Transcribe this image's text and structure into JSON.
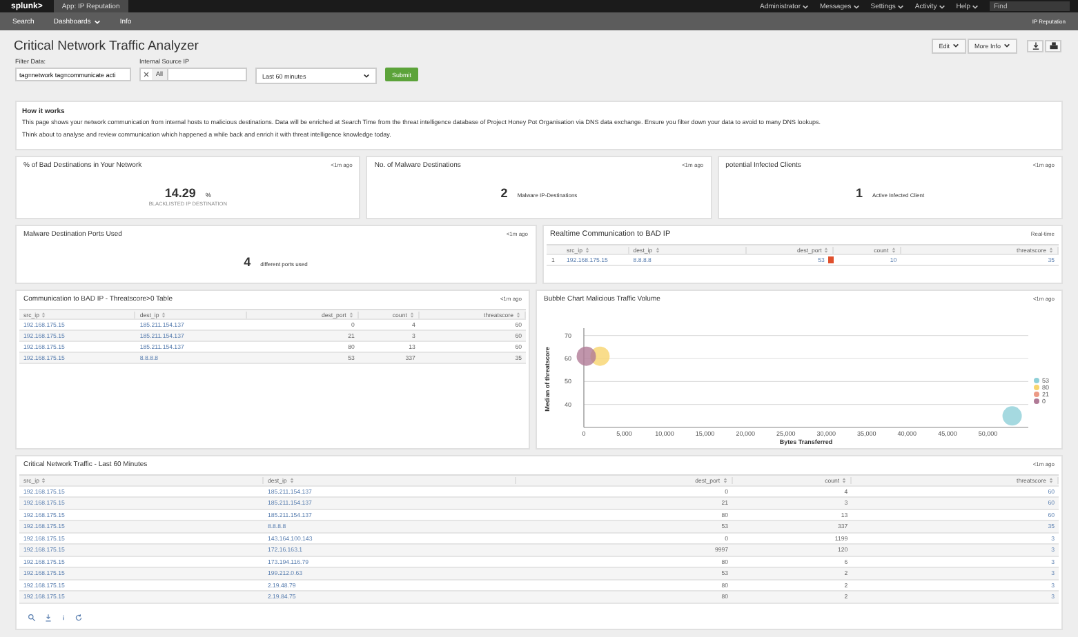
{
  "top_bar": {
    "logo": "splunk>",
    "app": "App: IP Reputation",
    "menus": [
      "Administrator",
      "Messages",
      "Settings",
      "Activity",
      "Help"
    ],
    "find_placeholder": "Find"
  },
  "nav": {
    "items": [
      {
        "label": "Search",
        "dropdown": false
      },
      {
        "label": "Dashboards",
        "dropdown": true
      },
      {
        "label": "Info",
        "dropdown": false
      }
    ],
    "app_label": "IP Reputation"
  },
  "dashboard": {
    "title": "Critical Network Traffic Analyzer",
    "buttons": [
      "Edit",
      "More Info"
    ]
  },
  "filters": {
    "filter_data": {
      "label": "Filter Data:",
      "value": "tag=network tag=communicate acti"
    },
    "source_ip": {
      "label": "Internal Source IP",
      "token": "All"
    },
    "time": {
      "value": "Last 60 minutes"
    },
    "submit": "Submit"
  },
  "how_it_works": {
    "heading": "How it works",
    "paragraphs": [
      "This page shows your network communication from internal hosts to malicious destinations. Data will be enriched at Search Time from the threat intelligence database of Project Honey Pot Organisation via DNS data exchange. Ensure you filter down your data to avoid to many DNS lookups.",
      "Think about to analyse and review communication which happened a while back and enrich it with threat intelligence knowledge today."
    ]
  },
  "single_panels": [
    {
      "title": "% of Bad Destinations in Your Network",
      "age": "<1m ago",
      "value": "14.29",
      "unit": "%",
      "caption": "BLACKLISTED IP DESTINATION"
    },
    {
      "title": "No. of Malware Destinations",
      "age": "<1m ago",
      "value": "2",
      "caption": "Malware IP-Destinations"
    },
    {
      "title": "potential Infected Clients",
      "age": "<1m ago",
      "value": "1",
      "caption": "Active Infected Client"
    }
  ],
  "ports_panel": {
    "title": "Malware Destination Ports Used",
    "age": "<1m ago",
    "value": "4",
    "caption": "different ports used"
  },
  "realtime_panel": {
    "title": "Realtime Communication to BAD IP",
    "age": "Real-time",
    "columns": [
      "src_ip",
      "dest_ip",
      "dest_port",
      "count",
      "threatscore"
    ],
    "rows": [
      {
        "number": "1",
        "cells": [
          "192.168.175.15",
          "8.8.8.8",
          "53",
          "10",
          "35"
        ]
      }
    ]
  },
  "threat_table": {
    "title": "Communication to BAD IP - Threatscore>0 Table",
    "age": "<1m ago",
    "columns": [
      "src_ip",
      "dest_ip",
      "dest_port",
      "count",
      "threatscore"
    ],
    "rows": [
      [
        "192.168.175.15",
        "185.211.154.137",
        "0",
        "4",
        "60"
      ],
      [
        "192.168.175.15",
        "185.211.154.137",
        "21",
        "3",
        "60"
      ],
      [
        "192.168.175.15",
        "185.211.154.137",
        "80",
        "13",
        "60"
      ],
      [
        "192.168.175.15",
        "8.8.8.8",
        "53",
        "337",
        "35"
      ]
    ]
  },
  "bubble_panel": {
    "title": "Bubble Chart Malicious Traffic Volume",
    "age": "<1m ago",
    "chart_data": {
      "type": "scatter",
      "xlabel": "Bytes Transferred",
      "ylabel": "Median of threatscore",
      "xlim": [
        0,
        55000
      ],
      "ylim": [
        30,
        72
      ],
      "xticks": [
        0,
        {
          "value": 5000,
          "label": "5,000"
        },
        {
          "value": 10000,
          "label": "10,000"
        },
        {
          "value": 15000,
          "label": "15,000"
        },
        {
          "value": 20000,
          "label": "20,000"
        },
        {
          "value": 25000,
          "label": "25,000"
        },
        {
          "value": 30000,
          "label": "30,000"
        },
        {
          "value": 35000,
          "label": "35,000"
        },
        {
          "value": 40000,
          "label": "40,000"
        },
        {
          "value": 45000,
          "label": "45,000"
        },
        {
          "value": 50000,
          "label": "50,000"
        }
      ],
      "yticks": [
        40,
        50,
        60,
        70
      ],
      "grid": true,
      "legend": "right",
      "series": [
        {
          "name": "53",
          "color": "#8fd0d8",
          "x": [
            53000
          ],
          "values": [
            35
          ]
        },
        {
          "name": "80",
          "color": "#f7d56e",
          "x": [
            2000
          ],
          "values": [
            61
          ]
        },
        {
          "name": "21",
          "color": "#ec9a85",
          "x": [
            null
          ],
          "values": [
            null
          ]
        },
        {
          "name": "0",
          "color": "#b07a96",
          "x": [
            300
          ],
          "values": [
            61
          ]
        }
      ]
    }
  },
  "traffic_table": {
    "title": "Critical Network Traffic - Last 60 Minutes",
    "age": "<1m ago",
    "columns": [
      "src_ip",
      "dest_ip",
      "dest_port",
      "count",
      "threatscore"
    ],
    "rows": [
      [
        "192.168.175.15",
        "185.211.154.137",
        "0",
        "4",
        "60"
      ],
      [
        "192.168.175.15",
        "185.211.154.137",
        "21",
        "3",
        "60"
      ],
      [
        "192.168.175.15",
        "185.211.154.137",
        "80",
        "13",
        "60"
      ],
      [
        "192.168.175.15",
        "8.8.8.8",
        "53",
        "337",
        "35"
      ],
      [
        "192.168.175.15",
        "143.164.100.143",
        "0",
        "1199",
        "3"
      ],
      [
        "192.168.175.15",
        "172.16.163.1",
        "9997",
        "120",
        "3"
      ],
      [
        "192.168.175.15",
        "173.194.116.79",
        "80",
        "6",
        "3"
      ],
      [
        "192.168.175.15",
        "199.212.0.63",
        "53",
        "2",
        "3"
      ],
      [
        "192.168.175.15",
        "2.19.48.79",
        "80",
        "2",
        "3"
      ],
      [
        "192.168.175.15",
        "2.19.84.75",
        "80",
        "2",
        "3"
      ]
    ]
  }
}
